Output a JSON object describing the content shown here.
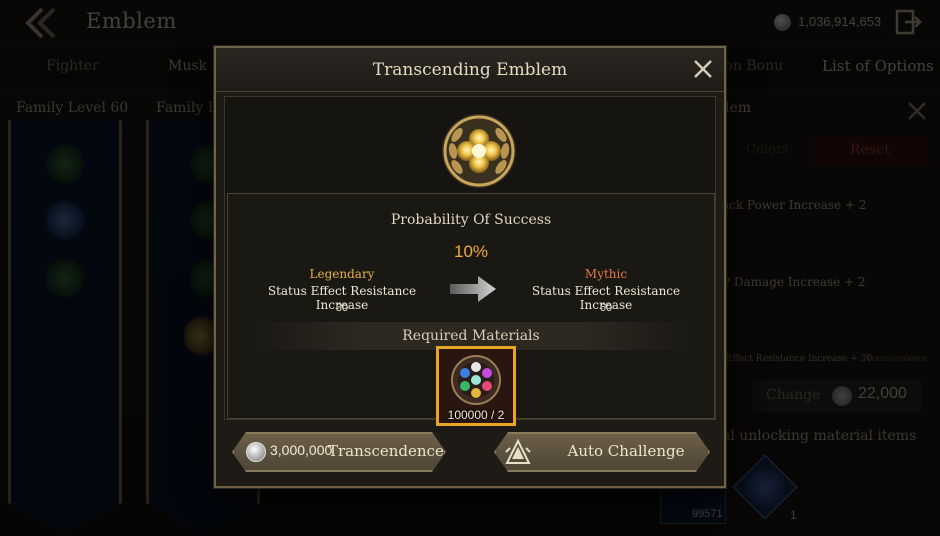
{
  "header": {
    "title": "Emblem",
    "currency": "1,036,914,653"
  },
  "tabs": [
    "Fighter",
    "Musk",
    "ion Bonu"
  ],
  "list_options": "List of Options",
  "family": {
    "label_1": "Family Level 60",
    "label_2": "Family L"
  },
  "right_panel": {
    "title": "blem",
    "faded_label": "Colors",
    "reset": "Reset",
    "line_1": "ack Power Increase + 2",
    "line_2": "P Damage Increase + 2",
    "line_3": "Effect Resistance Increase + 30",
    "line_3_tag": "Transcendence",
    "change": "Change",
    "change_cost": "22,000",
    "unlock_text": "al unlocking material items",
    "item_1_count": "99571",
    "item_2_count": "1"
  },
  "modal": {
    "title": "Transcending Emblem",
    "probability_label": "Probability Of Success",
    "probability_value": "10%",
    "from": {
      "grade": "Legendary",
      "stat": "Status Effect Resistance Increase",
      "value": "30"
    },
    "to": {
      "grade": "Mythic",
      "stat": "Status Effect Resistance Increase",
      "value": "60"
    },
    "required_label": "Required Materials",
    "material_count": "100000 / 2",
    "transcend_cost": "3,000,000",
    "transcend_label": "Transcendence",
    "auto_label": "Auto Challenge"
  },
  "colors": {
    "legendary": "#e9b249",
    "mythic": "#e8774a",
    "probability": "#f0a73b",
    "highlight": "#e7a623"
  }
}
